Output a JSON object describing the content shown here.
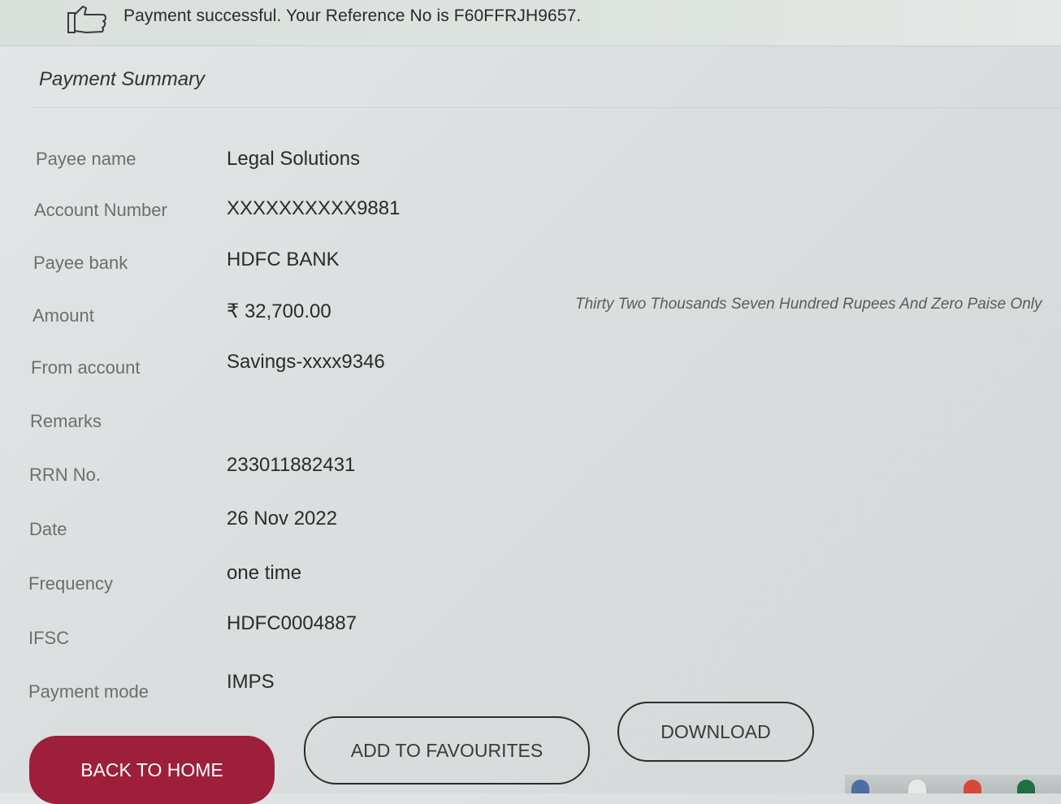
{
  "banner": {
    "message": "Payment successful. Your Reference No is F60FFRJH9657."
  },
  "summary": {
    "title": "Payment Summary",
    "rows": [
      {
        "label": "Payee name",
        "value": "Legal Solutions"
      },
      {
        "label": "Account Number",
        "value": "XXXXXXXXXX9881"
      },
      {
        "label": "Payee bank",
        "value": "HDFC BANK"
      },
      {
        "label": "Amount",
        "value": "₹ 32,700.00"
      },
      {
        "label": "From account",
        "value": "Savings-xxxx9346"
      },
      {
        "label": "Remarks",
        "value": ""
      },
      {
        "label": "RRN No.",
        "value": "233011882431"
      },
      {
        "label": "Date",
        "value": "26 Nov 2022"
      },
      {
        "label": "Frequency",
        "value": "one time"
      },
      {
        "label": "IFSC",
        "value": "HDFC0004887"
      },
      {
        "label": "Payment mode",
        "value": "IMPS"
      }
    ],
    "amount_in_words": "Thirty Two Thousands Seven Hundred Rupees And Zero Paise Only"
  },
  "actions": {
    "back_to_home": "BACK TO HOME",
    "add_to_favourites": "ADD TO FAVOURITES",
    "download": "DOWNLOAD"
  },
  "icons": {
    "banner_icon": "thumbs-up-icon"
  },
  "colors": {
    "primary_button": "#9e1f3a",
    "background": "#dadede",
    "banner": "#dde3df"
  }
}
